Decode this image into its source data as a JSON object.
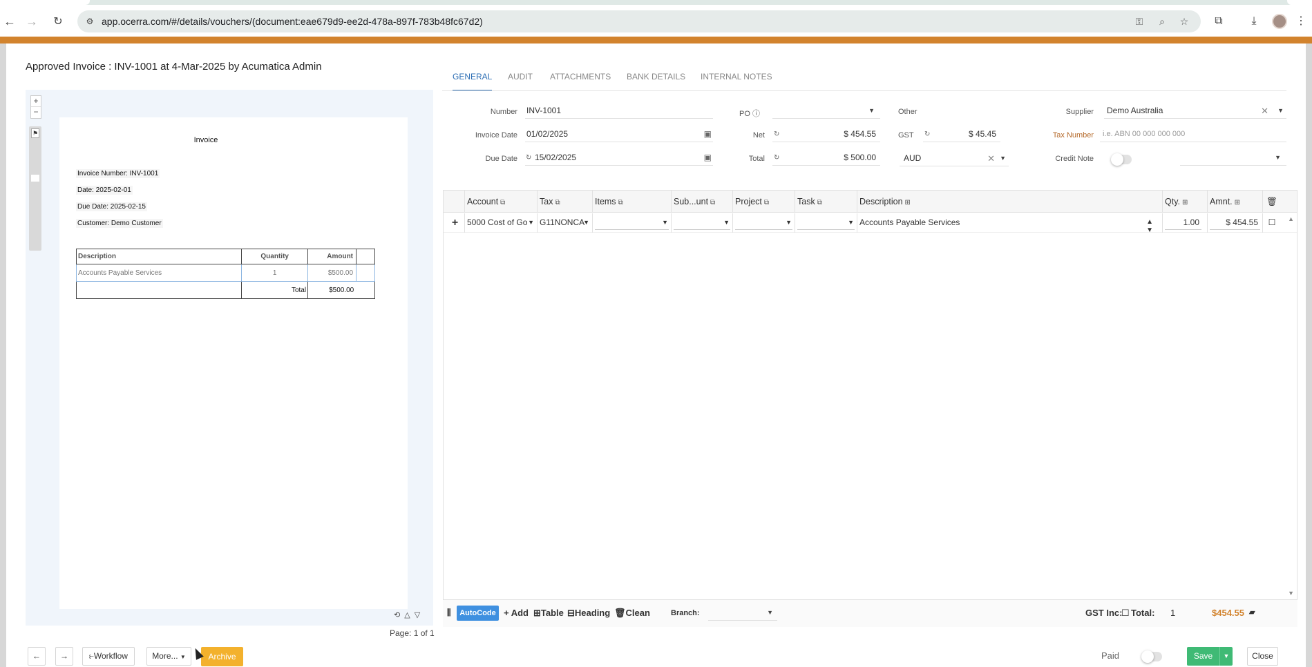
{
  "browser": {
    "url": "app.ocerra.com/#/details/vouchers/(document:eae679d9-ee2d-478a-897f-783b48fc67d2)",
    "back_icon": "arrow-left",
    "forward_icon": "arrow-right",
    "reload_icon": "refresh"
  },
  "header": {
    "title": "Approved Invoice : INV-1001 at 4-Mar-2025 by Acumatica Admin"
  },
  "preview": {
    "zoom_in": "+",
    "zoom_out": "−",
    "invoice_title": "Invoice",
    "lines": {
      "number": "Invoice Number: INV-1001",
      "date": "Date: 2025-02-01",
      "due": "Due Date: 2025-02-15",
      "customer": "Customer: Demo Customer"
    },
    "table": {
      "headers": [
        "Description",
        "Quantity",
        "Amount"
      ],
      "row": [
        "Accounts Payable Services",
        "1",
        "$500.00"
      ],
      "total_label": "Total",
      "total_value": "$500.00"
    },
    "page_info": "Page: 1 of 1"
  },
  "tabs": [
    "GENERAL",
    "AUDIT",
    "ATTACHMENTS",
    "BANK DETAILS",
    "INTERNAL NOTES"
  ],
  "form": {
    "number_label": "Number",
    "number": "INV-1001",
    "po_label": "PO",
    "other_label": "Other",
    "supplier_label": "Supplier",
    "supplier": "Demo Australia",
    "invoice_date_label": "Invoice Date",
    "invoice_date": "01/02/2025",
    "net_label": "Net",
    "net": "$ 454.55",
    "gst_label": "GST",
    "gst": "$ 45.45",
    "tax_number_label": "Tax Number",
    "tax_number_placeholder": "i.e. ABN 00 000 000 000",
    "due_date_label": "Due Date",
    "due_date": "15/02/2025",
    "total_label": "Total",
    "total": "$ 500.00",
    "currency": "AUD",
    "credit_note_label": "Credit Note"
  },
  "grid": {
    "headers": {
      "account": "Account",
      "tax": "Tax",
      "items": "Items",
      "subunit": "Sub...unt",
      "project": "Project",
      "task": "Task",
      "description": "Description",
      "qty": "Qty.",
      "amount": "Amnt."
    },
    "row": {
      "add": "+",
      "account": "5000 Cost of Go",
      "tax": "G11NONCA",
      "description": "Accounts Payable Services",
      "qty": "1.00",
      "amount": "$ 454.55"
    }
  },
  "footer": {
    "autocode": "AutoCode",
    "add": "+ Add",
    "table": "Table",
    "heading": "Heading",
    "clean": "Clean",
    "branch_label": "Branch:",
    "gst_inc_label": "GST Inc:",
    "total_label": "Total:",
    "count": "1",
    "total_amount": "$454.55"
  },
  "actions": {
    "prev": "←",
    "next": "→",
    "workflow": "Workflow",
    "more": "More...",
    "archive": "Archive",
    "paid_label": "Paid",
    "save": "Save",
    "close": "Close"
  },
  "colors": {
    "accent": "#2e6fb5",
    "band": "#d2832d",
    "archive": "#f3b12d",
    "save": "#3fba75",
    "autocode": "#3f90e0",
    "total_amount": "#d2832d"
  }
}
